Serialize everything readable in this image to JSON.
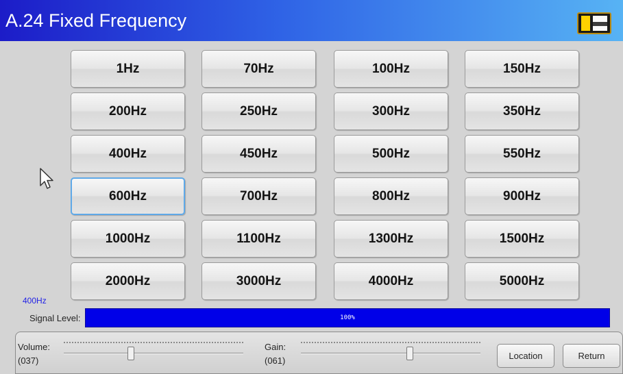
{
  "header": {
    "title": "A.24 Fixed Frequency"
  },
  "frequency_buttons": [
    "1Hz",
    "70Hz",
    "100Hz",
    "150Hz",
    "200Hz",
    "250Hz",
    "300Hz",
    "350Hz",
    "400Hz",
    "450Hz",
    "500Hz",
    "550Hz",
    "600Hz",
    "700Hz",
    "800Hz",
    "900Hz",
    "1000Hz",
    "1100Hz",
    "1300Hz",
    "1500Hz",
    "2000Hz",
    "3000Hz",
    "4000Hz",
    "5000Hz"
  ],
  "focused_button": "600Hz",
  "status": {
    "current_frequency": "400Hz",
    "signal_label": "Signal Level:",
    "signal_percent_text": "100%",
    "signal_level": 1.0
  },
  "controls": {
    "volume_label": "Volume:",
    "volume_value": "(037)",
    "volume_level": 0.37,
    "gain_label": "Gain:",
    "gain_value": "(061)",
    "gain_level": 0.61,
    "location_button": "Location",
    "return_button": "Return"
  },
  "colors": {
    "title_bar_start": "#1c1cc8",
    "title_bar_end": "#57b3f4",
    "signal_fill": "#0000e8",
    "current_frequency_text": "#2222e6",
    "focus_border": "#5fa9e8"
  },
  "icons": {
    "battery": "battery-icon",
    "cursor": "mouse-pointer-icon"
  }
}
